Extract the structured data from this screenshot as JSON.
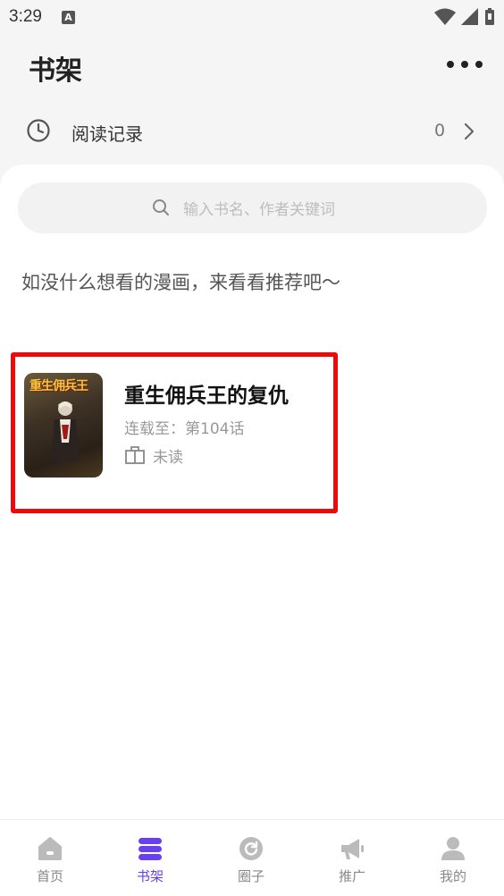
{
  "status_bar": {
    "time": "3:29",
    "notification_badge": "A"
  },
  "header": {
    "title": "书架"
  },
  "history": {
    "label": "阅读记录",
    "count": "0"
  },
  "search": {
    "placeholder": "输入书名、作者关键词"
  },
  "recommend_text": "如没什么想看的漫画，来看看推荐吧～",
  "book": {
    "title": "重生佣兵王的复仇",
    "progress": "连载至：第104话",
    "read_status": "未读",
    "cover_text": "重生佣兵王"
  },
  "tabs": [
    {
      "label": "首页",
      "icon": "home-icon",
      "active": false
    },
    {
      "label": "书架",
      "icon": "bookshelf-icon",
      "active": true
    },
    {
      "label": "圈子",
      "icon": "circle-refresh-icon",
      "active": false
    },
    {
      "label": "推广",
      "icon": "megaphone-icon",
      "active": false
    },
    {
      "label": "我的",
      "icon": "user-icon",
      "active": false
    }
  ],
  "colors": {
    "accent": "#6a3ff0",
    "highlight_border": "#ee0a0a",
    "background": "#f5f5f5"
  }
}
